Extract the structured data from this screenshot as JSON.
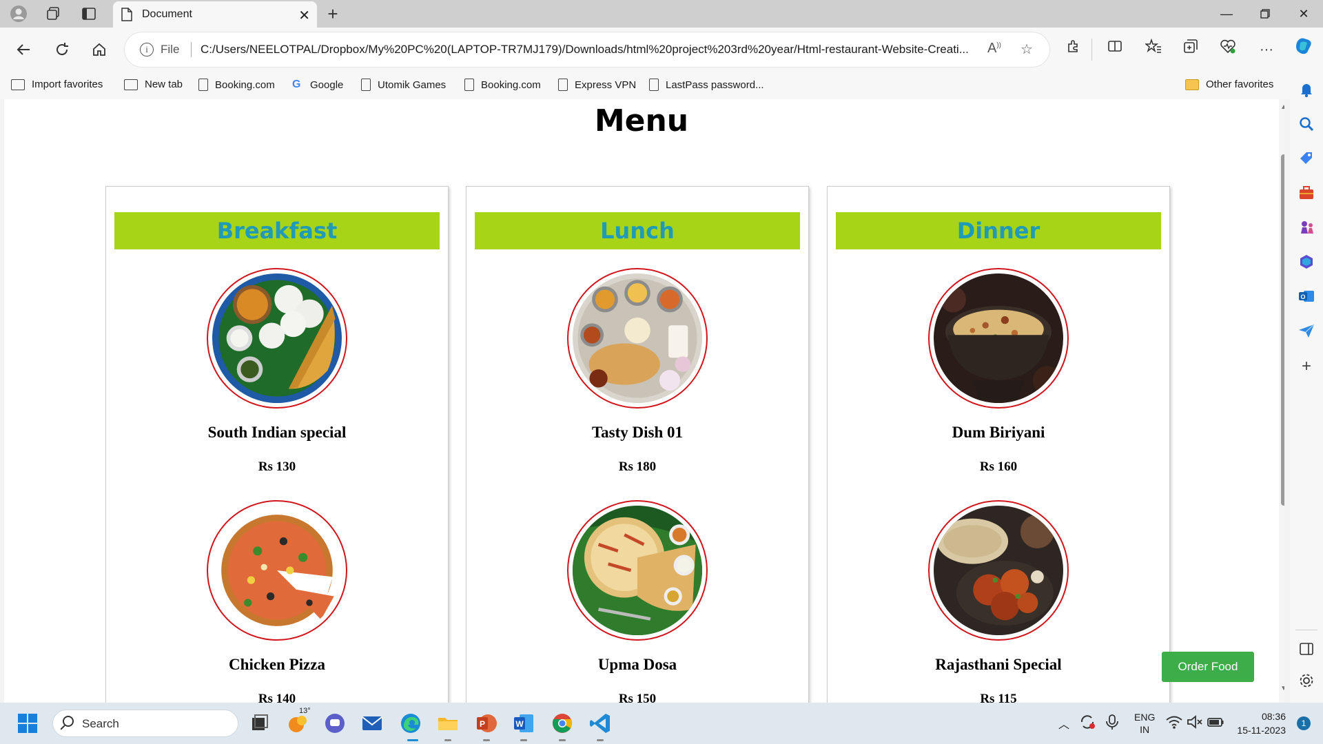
{
  "browser": {
    "tab_title": "Document",
    "address_scheme": "File",
    "address_url": "C:/Users/NEELOTPAL/Dropbox/My%20PC%20(LAPTOP-TR7MJ179)/Downloads/html%20project%203rd%20year/Html-restaurant-Website-Creati..."
  },
  "favorites": [
    {
      "label": "Import favorites",
      "icon": "import-icon"
    },
    {
      "label": "New tab",
      "icon": "newtab-icon"
    },
    {
      "label": "Booking.com",
      "icon": "page-icon"
    },
    {
      "label": "Google",
      "icon": "google-icon"
    },
    {
      "label": "Utomik Games",
      "icon": "page-icon"
    },
    {
      "label": "Booking.com",
      "icon": "page-icon"
    },
    {
      "label": "Express VPN",
      "icon": "page-icon"
    },
    {
      "label": "LastPass password...",
      "icon": "page-icon"
    }
  ],
  "other_favorites": "Other favorites",
  "page": {
    "title": "Menu",
    "order_button": "Order Food",
    "sections": [
      {
        "heading": "Breakfast",
        "items": [
          {
            "name": "South Indian special",
            "price": "Rs 130"
          },
          {
            "name": "Chicken Pizza",
            "price": "Rs 140"
          }
        ]
      },
      {
        "heading": "Lunch",
        "items": [
          {
            "name": "Tasty Dish 01",
            "price": "Rs 180"
          },
          {
            "name": "Upma Dosa",
            "price": "Rs 150"
          }
        ]
      },
      {
        "heading": "Dinner",
        "items": [
          {
            "name": "Dum Biriyani",
            "price": "Rs 160"
          },
          {
            "name": "Rajasthani Special",
            "price": "Rs 115"
          }
        ]
      }
    ]
  },
  "taskbar": {
    "search_label": "Search",
    "weather_temp": "13°",
    "lang_top": "ENG",
    "lang_bottom": "IN",
    "time": "08:36",
    "date": "15-11-2023",
    "notification_count": "1"
  },
  "colors": {
    "heading_bg": "#a8d418",
    "heading_text": "#1f9bb8",
    "image_border": "#d1141b",
    "order_button": "#3cad48"
  }
}
